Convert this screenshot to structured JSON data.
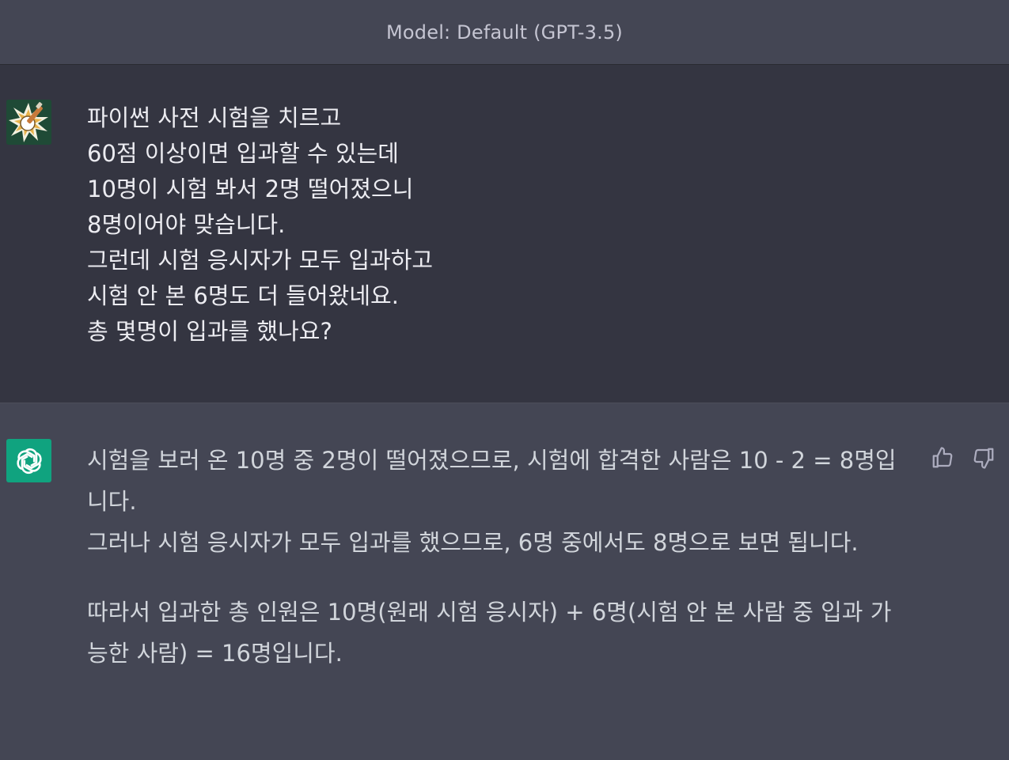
{
  "header": {
    "model_label": "Model: Default (GPT-3.5)"
  },
  "user_message": {
    "avatar_icon": "user-avatar-icon",
    "lines": [
      "파이썬 사전 시험을 치르고",
      "60점 이상이면 입과할 수 있는데",
      "10명이 시험 봐서 2명 떨어졌으니",
      "8명이어야 맞습니다.",
      "그런데 시험 응시자가 모두 입과하고",
      "시험 안 본 6명도 더 들어왔네요.",
      "총 몇명이 입과를 했나요?"
    ]
  },
  "assistant_message": {
    "avatar_icon": "openai-logo-icon",
    "paragraphs": [
      "시험을 보러 온 10명 중 2명이 떨어졌으므로, 시험에 합격한 사람은 10 - 2 = 8명입니다.",
      "그러나 시험 응시자가 모두 입과를 했으므로, 6명 중에서도 8명으로 보면 됩니다.",
      "따라서 입과한 총 인원은 10명(원래 시험 응시자) + 6명(시험 안 본 사람 중 입과 가능한 사람) = 16명입니다."
    ],
    "feedback": {
      "thumbs_up_icon": "thumbs-up-icon",
      "thumbs_down_icon": "thumbs-down-icon"
    }
  },
  "colors": {
    "background": "#343541",
    "assistant_background": "#444654",
    "openai_green": "#10a37f",
    "text_primary": "#ececf1",
    "text_secondary": "#d1d5db"
  }
}
